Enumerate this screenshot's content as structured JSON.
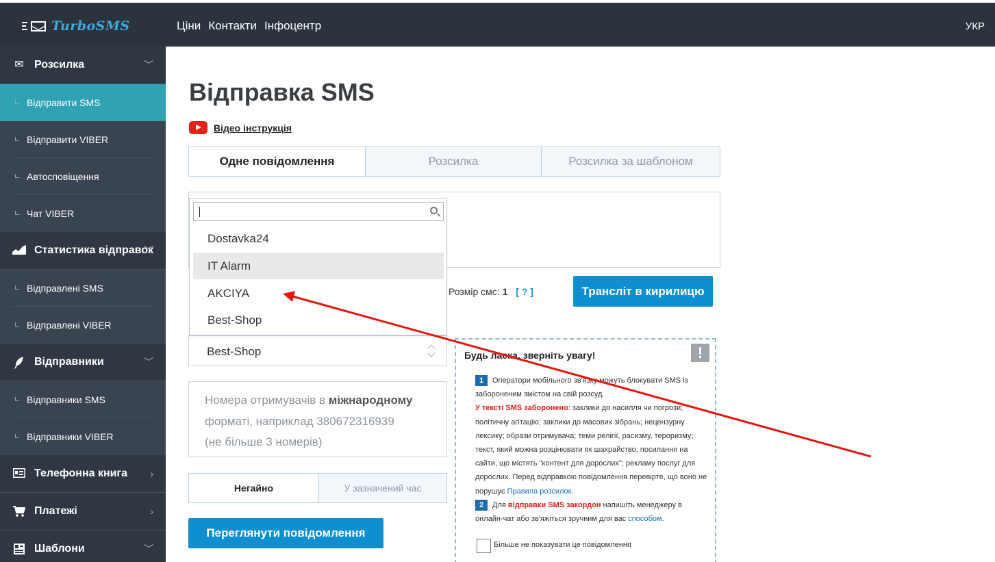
{
  "header": {
    "brand": "TurboSMS",
    "nav": [
      "Ціни",
      "Контакти",
      "Інфоцентр"
    ],
    "lang": "УКР"
  },
  "sidebar": {
    "sections": [
      {
        "label": "Розсилка",
        "icon": "envelope-icon",
        "arrow": "chevron-down-icon",
        "items": [
          {
            "label": "Відправити SMS",
            "active": true
          },
          {
            "label": "Відправити VIBER"
          },
          {
            "label": "Автосповіщення"
          },
          {
            "label": "Чат VIBER"
          }
        ]
      },
      {
        "label": "Статистика відправок",
        "icon": "chart-icon",
        "arrow": "chevron-down-icon",
        "items": [
          {
            "label": "Відправлені SMS"
          },
          {
            "label": "Відправлені VIBER"
          }
        ]
      },
      {
        "label": "Відправники",
        "icon": "feather-icon",
        "arrow": "chevron-down-icon",
        "items": [
          {
            "label": "Відправники SMS"
          },
          {
            "label": "Відправники VIBER"
          }
        ]
      },
      {
        "label": "Телефонна книга",
        "icon": "phonebook-icon",
        "arrow": "chevron-right-icon",
        "items": []
      },
      {
        "label": "Платежі",
        "icon": "cart-icon",
        "arrow": "chevron-right-icon",
        "items": []
      },
      {
        "label": "Шаблони",
        "icon": "template-icon",
        "arrow": "chevron-down-icon",
        "items": []
      }
    ]
  },
  "main": {
    "title": "Відправка SMS",
    "video_link": "Відео інструкція",
    "tabs": [
      "Одне повідомлення",
      "Розсилка",
      "Розсилка за шаблоном"
    ],
    "size_label": "Розмір смс:",
    "size_value": "1",
    "size_help": "[ ? ]",
    "translit_button": "Трансліт в кирилицю",
    "sender_selected": "Best-Shop",
    "sender_options": [
      "Dostavka24",
      "IT Alarm",
      "AKCIYA",
      "Best-Shop"
    ],
    "sender_search_value": "",
    "phones_line1_pre": "Номера отримувачів в",
    "phones_line1_bold": "міжнародному",
    "phones_line2": "форматі, наприклад 380672316939",
    "phones_line3": "(не більше 3 номерів)",
    "when_tabs": [
      "Негайно",
      "У зазначений час"
    ],
    "preview_button": "Переглянути повідомлення"
  },
  "notice": {
    "title": "Будь ласка, зверніть увагу!",
    "excl": "!",
    "p1_num": "1",
    "p1_text": "Оператори мобільного зв'язку можуть блокувати SMS із забороненим змістом на свій розсуд.",
    "p1_red": "У тексті SMS заборонено",
    "p1_rest": ": заклики до насилля чи погрози; політичну агітацію; заклики до масових зібрань; нецензурну лексику; образи отримувача; теми релігії, расизму, тероризму; текст, який можна розцінювати як шахрайство; посилання на сайти, що містять \"контент для дорослих\"; рекламу послуг для дорослих. Перед відправкою повідомлення перевірте, що воно не порушує",
    "p1_link": "Правила розсилок",
    "p1_end": ".",
    "p2_num": "2",
    "p2_pre": "Для",
    "p2_red": "відправки SMS закордон",
    "p2_rest": "напишіть менеджеру в онлайн-чат або зв'яжіться зручним для вас",
    "p2_link": "способом",
    "p2_end": ".",
    "checkbox_label": "Більше не показувати це повідомлення"
  },
  "colors": {
    "header_bg": "#2b333d",
    "sidebar_bg": "#3a4350",
    "active_item": "#2fa3b4",
    "primary_button": "#0f8fd0",
    "annotation_arrow": "#e8150f"
  }
}
